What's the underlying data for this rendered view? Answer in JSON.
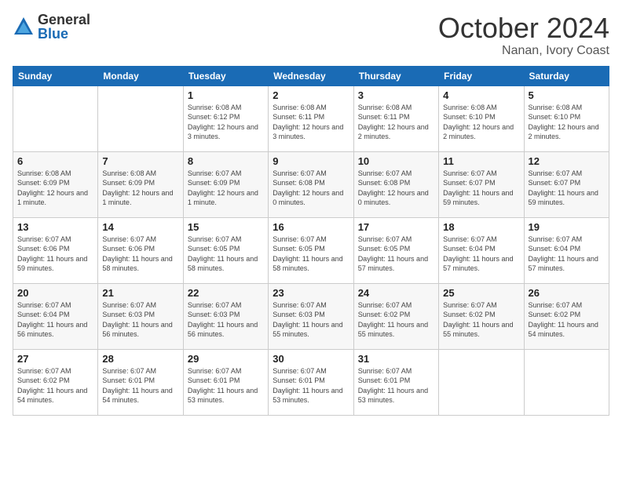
{
  "logo": {
    "general": "General",
    "blue": "Blue"
  },
  "header": {
    "month": "October 2024",
    "location": "Nanan, Ivory Coast"
  },
  "weekdays": [
    "Sunday",
    "Monday",
    "Tuesday",
    "Wednesday",
    "Thursday",
    "Friday",
    "Saturday"
  ],
  "weeks": [
    [
      null,
      null,
      {
        "day": 1,
        "sunrise": "6:08 AM",
        "sunset": "6:12 PM",
        "daylight": "12 hours and 3 minutes."
      },
      {
        "day": 2,
        "sunrise": "6:08 AM",
        "sunset": "6:11 PM",
        "daylight": "12 hours and 3 minutes."
      },
      {
        "day": 3,
        "sunrise": "6:08 AM",
        "sunset": "6:11 PM",
        "daylight": "12 hours and 2 minutes."
      },
      {
        "day": 4,
        "sunrise": "6:08 AM",
        "sunset": "6:10 PM",
        "daylight": "12 hours and 2 minutes."
      },
      {
        "day": 5,
        "sunrise": "6:08 AM",
        "sunset": "6:10 PM",
        "daylight": "12 hours and 2 minutes."
      }
    ],
    [
      {
        "day": 6,
        "sunrise": "6:08 AM",
        "sunset": "6:09 PM",
        "daylight": "12 hours and 1 minute."
      },
      {
        "day": 7,
        "sunrise": "6:08 AM",
        "sunset": "6:09 PM",
        "daylight": "12 hours and 1 minute."
      },
      {
        "day": 8,
        "sunrise": "6:07 AM",
        "sunset": "6:09 PM",
        "daylight": "12 hours and 1 minute."
      },
      {
        "day": 9,
        "sunrise": "6:07 AM",
        "sunset": "6:08 PM",
        "daylight": "12 hours and 0 minutes."
      },
      {
        "day": 10,
        "sunrise": "6:07 AM",
        "sunset": "6:08 PM",
        "daylight": "12 hours and 0 minutes."
      },
      {
        "day": 11,
        "sunrise": "6:07 AM",
        "sunset": "6:07 PM",
        "daylight": "11 hours and 59 minutes."
      },
      {
        "day": 12,
        "sunrise": "6:07 AM",
        "sunset": "6:07 PM",
        "daylight": "11 hours and 59 minutes."
      }
    ],
    [
      {
        "day": 13,
        "sunrise": "6:07 AM",
        "sunset": "6:06 PM",
        "daylight": "11 hours and 59 minutes."
      },
      {
        "day": 14,
        "sunrise": "6:07 AM",
        "sunset": "6:06 PM",
        "daylight": "11 hours and 58 minutes."
      },
      {
        "day": 15,
        "sunrise": "6:07 AM",
        "sunset": "6:05 PM",
        "daylight": "11 hours and 58 minutes."
      },
      {
        "day": 16,
        "sunrise": "6:07 AM",
        "sunset": "6:05 PM",
        "daylight": "11 hours and 58 minutes."
      },
      {
        "day": 17,
        "sunrise": "6:07 AM",
        "sunset": "6:05 PM",
        "daylight": "11 hours and 57 minutes."
      },
      {
        "day": 18,
        "sunrise": "6:07 AM",
        "sunset": "6:04 PM",
        "daylight": "11 hours and 57 minutes."
      },
      {
        "day": 19,
        "sunrise": "6:07 AM",
        "sunset": "6:04 PM",
        "daylight": "11 hours and 57 minutes."
      }
    ],
    [
      {
        "day": 20,
        "sunrise": "6:07 AM",
        "sunset": "6:04 PM",
        "daylight": "11 hours and 56 minutes."
      },
      {
        "day": 21,
        "sunrise": "6:07 AM",
        "sunset": "6:03 PM",
        "daylight": "11 hours and 56 minutes."
      },
      {
        "day": 22,
        "sunrise": "6:07 AM",
        "sunset": "6:03 PM",
        "daylight": "11 hours and 56 minutes."
      },
      {
        "day": 23,
        "sunrise": "6:07 AM",
        "sunset": "6:03 PM",
        "daylight": "11 hours and 55 minutes."
      },
      {
        "day": 24,
        "sunrise": "6:07 AM",
        "sunset": "6:02 PM",
        "daylight": "11 hours and 55 minutes."
      },
      {
        "day": 25,
        "sunrise": "6:07 AM",
        "sunset": "6:02 PM",
        "daylight": "11 hours and 55 minutes."
      },
      {
        "day": 26,
        "sunrise": "6:07 AM",
        "sunset": "6:02 PM",
        "daylight": "11 hours and 54 minutes."
      }
    ],
    [
      {
        "day": 27,
        "sunrise": "6:07 AM",
        "sunset": "6:02 PM",
        "daylight": "11 hours and 54 minutes."
      },
      {
        "day": 28,
        "sunrise": "6:07 AM",
        "sunset": "6:01 PM",
        "daylight": "11 hours and 54 minutes."
      },
      {
        "day": 29,
        "sunrise": "6:07 AM",
        "sunset": "6:01 PM",
        "daylight": "11 hours and 53 minutes."
      },
      {
        "day": 30,
        "sunrise": "6:07 AM",
        "sunset": "6:01 PM",
        "daylight": "11 hours and 53 minutes."
      },
      {
        "day": 31,
        "sunrise": "6:07 AM",
        "sunset": "6:01 PM",
        "daylight": "11 hours and 53 minutes."
      },
      null,
      null
    ]
  ]
}
